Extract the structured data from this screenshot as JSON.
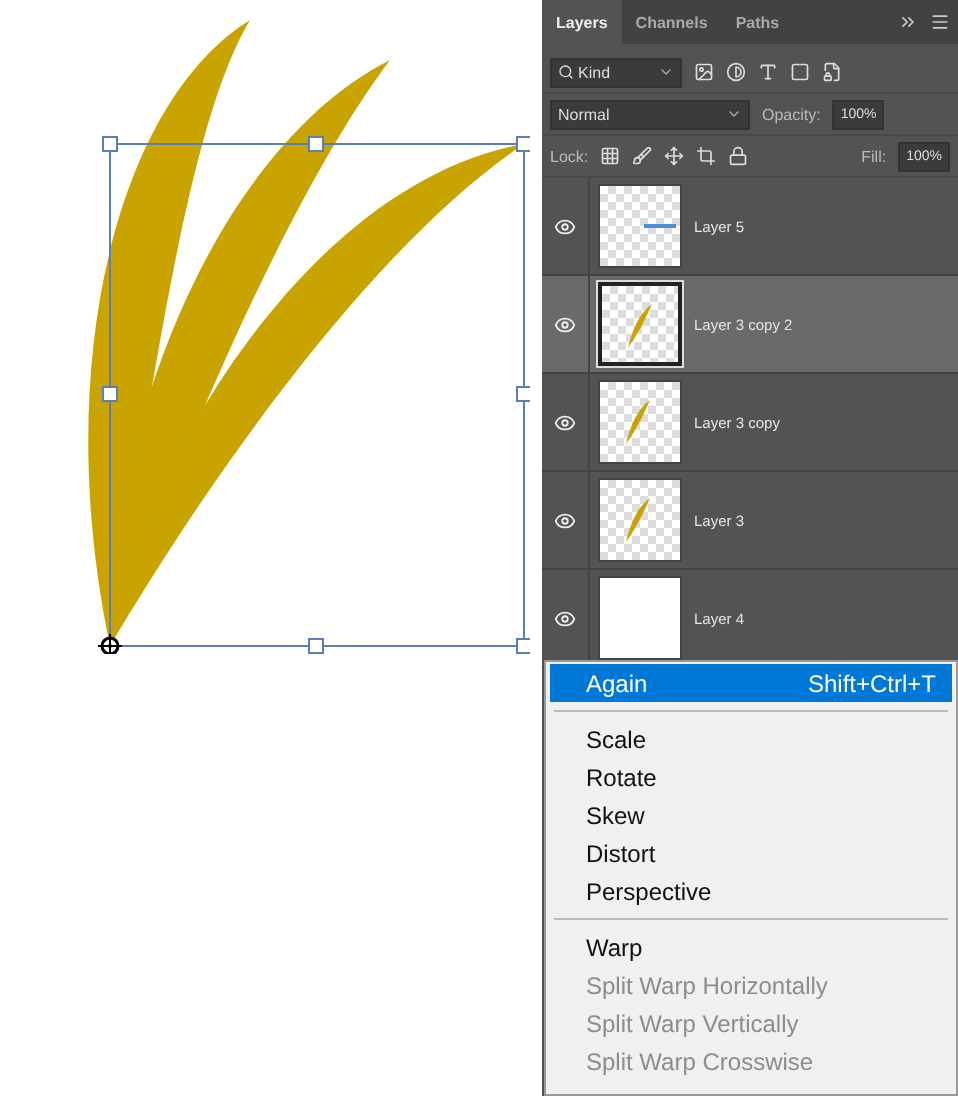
{
  "layers_panel": {
    "tabs": [
      {
        "label": "Layers",
        "selected": true
      },
      {
        "label": "Channels",
        "selected": false
      },
      {
        "label": "Paths",
        "selected": false
      }
    ],
    "filter": {
      "value": "Kind"
    },
    "blend_mode": {
      "value": "Normal"
    },
    "opacity": {
      "label": "Opacity:",
      "value": "100%"
    },
    "lock": {
      "label": "Lock:"
    },
    "fill": {
      "label": "Fill:",
      "value": "100%"
    },
    "layers": [
      {
        "name": "Layer 5",
        "visible": true,
        "selected": false,
        "kind": "stroke"
      },
      {
        "name": "Layer 3 copy 2",
        "visible": true,
        "selected": true,
        "kind": "leaf"
      },
      {
        "name": "Layer 3 copy",
        "visible": true,
        "selected": false,
        "kind": "leaf"
      },
      {
        "name": "Layer 3",
        "visible": true,
        "selected": false,
        "kind": "leaf"
      },
      {
        "name": "Layer 4",
        "visible": true,
        "selected": false,
        "kind": "white"
      }
    ]
  },
  "context_menu": {
    "groups": [
      [
        {
          "label": "Again",
          "shortcut": "Shift+Ctrl+T",
          "selected": true,
          "disabled": false
        }
      ],
      [
        {
          "label": "Scale",
          "selected": false,
          "disabled": false
        },
        {
          "label": "Rotate",
          "selected": false,
          "disabled": false
        },
        {
          "label": "Skew",
          "selected": false,
          "disabled": false
        },
        {
          "label": "Distort",
          "selected": false,
          "disabled": false
        },
        {
          "label": "Perspective",
          "selected": false,
          "disabled": false
        }
      ],
      [
        {
          "label": "Warp",
          "selected": false,
          "disabled": false
        },
        {
          "label": "Split Warp Horizontally",
          "selected": false,
          "disabled": true
        },
        {
          "label": "Split Warp Vertically",
          "selected": false,
          "disabled": true
        },
        {
          "label": "Split Warp Crosswise",
          "selected": false,
          "disabled": true
        }
      ]
    ]
  }
}
